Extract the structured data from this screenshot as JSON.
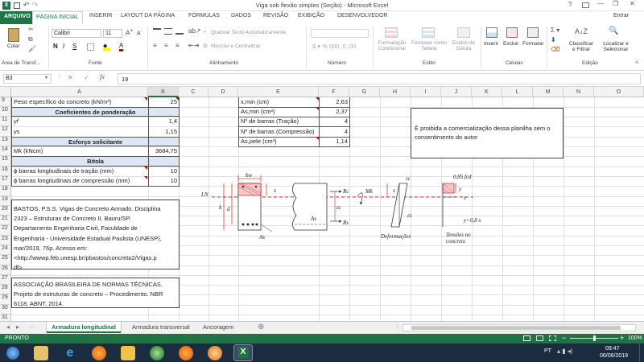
{
  "window": {
    "title": "Viga sob flexão simples (Seção) - Microsoft Excel",
    "help": "?",
    "minimize": "—",
    "restore": "❐",
    "close": "✕"
  },
  "ribbon_tabs": [
    "ARQUIVO",
    "PÁGINA INICIAL",
    "INSERIR",
    "LAYOUT DA PÁGINA",
    "FÓRMULAS",
    "DADOS",
    "REVISÃO",
    "EXIBIÇÃO",
    "DESENVOLVEDOR"
  ],
  "user": "Entrar",
  "ribbon": {
    "paste": "Colar",
    "font_name": "Calibri",
    "font_size": "11",
    "bold": "N",
    "italic": "I",
    "underline": "S",
    "wrap_text": "Quebrar Texto Automaticamente",
    "merge_center": "Mesclar e Centralizar",
    "cond_format": "Formatação\nCondicional",
    "format_table": "Formatar como\nTabela",
    "cell_styles": "Estilos de\nCélula",
    "insert": "Inserir",
    "delete": "Excluir",
    "format": "Formatar",
    "sort_filter": "Classificar\ne Filtrar",
    "find_select": "Localizar e\nSelecionar",
    "groups": [
      "Área de Transf...",
      "Fonte",
      "Alinhamento",
      "Número",
      "Estilo",
      "Células",
      "Edição"
    ]
  },
  "formula_bar": {
    "name_box": "B3",
    "fx": "fx",
    "value": "19"
  },
  "columns": [
    "A",
    "B",
    "C",
    "D",
    "E",
    "F",
    "G",
    "H",
    "I",
    "J",
    "K",
    "L",
    "M",
    "N",
    "O"
  ],
  "rows": [
    "9",
    "10",
    "11",
    "12",
    "13",
    "14",
    "15",
    "16",
    "17",
    "18",
    "19",
    "20",
    "21",
    "22",
    "23",
    "24",
    "25",
    "26",
    "27",
    "28",
    "29",
    "30",
    "31"
  ],
  "cells": {
    "a9": "Peso específico do concreto (kN/m³)",
    "b9": "25",
    "a10": "Coeficientes de ponderação",
    "a11": "γf",
    "b11": "1,4",
    "a12": "γs",
    "b12": "1,15",
    "a13": "Esforço solicitante",
    "a14": "Mk (kNcm)",
    "b14": "3684,75",
    "a15": "Bitola",
    "a16": "ϕ barras longitudinais de tração (mm)",
    "b16": "10",
    "a17": "ϕ barras longitudinais de compressão (mm)",
    "b17": "10",
    "e9": "x,min (cm)",
    "f9": "2,63",
    "e10": "As,min (cm²)",
    "f10": "2,37",
    "e11": "Nº de barras (Tração)",
    "f11": "4",
    "e12": "Nº de barras (Compressão)",
    "f12": "4",
    "e13": "As,pele (cm²)",
    "f13": "1,14"
  },
  "notice": "É proibida a comercialização dessa planilha sem o consentimento do autor",
  "ref1": [
    "BASTOS, P.S.S. Vigas de Concreto Armado. Disciplina",
    "2323 – Estruturas de Concreto II. Bauru/SP,",
    "Departamento Engenharia Civil, Faculdade de",
    "Engenharia - Universidade Estadual Paulista (UNESP),",
    "mar/2019, 76p. Acesso em:",
    "<http://wwwp.feb.unesp.br/pbastos/concreto2/Vigas.p",
    "df>"
  ],
  "ref2": [
    "ASSOCIAÇÃO BRASILEIRA DE NORMAS TÉCNICAS.",
    "Projeto de estruturas de concreto – Procedimento. NBR",
    "6118, ABNT, 2014."
  ],
  "diagram": {
    "bw": "bw",
    "LN": "LN",
    "h": "h",
    "d": "d",
    "As1": "As",
    "As2": "As",
    "x1": "x",
    "x2": "x",
    "x3": "x",
    "y": "y",
    "Rc": "Rc",
    "Rs": "Rs",
    "zc": "zc",
    "Mk": "Mk",
    "ec": "εc",
    "es": "εs",
    "deformacoes": "Deformações",
    "tensoes": "Tensões no\nconcreto",
    "fcd": "0,85 fcd",
    "y08": "y=0,8 x"
  },
  "sheet_tabs": [
    "Armadura longitudinal",
    "Armadura transversal",
    "Ancoragem"
  ],
  "add_sheet": "⊕",
  "status": {
    "ready": "PRONTO",
    "zoom": "100%"
  },
  "taskbar": {
    "lang": "PT",
    "time": "09:47",
    "date": "06/06/2019"
  },
  "colors": {
    "excel_green": "#217346",
    "header_fill": "#dde7f3",
    "diagram_red": "#c00000"
  }
}
